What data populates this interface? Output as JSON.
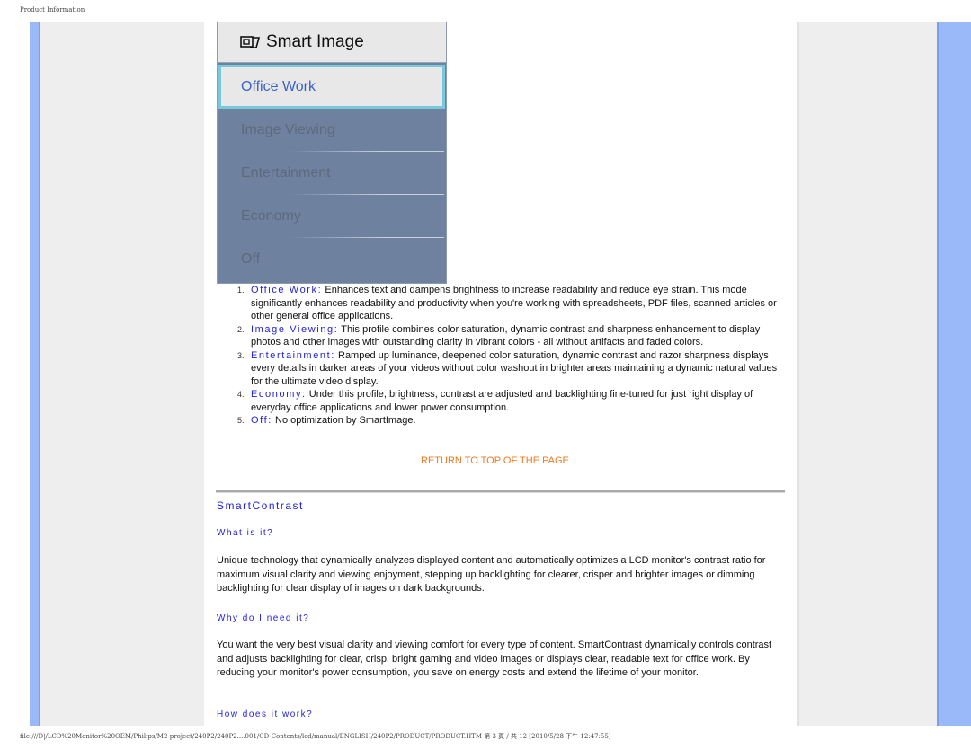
{
  "page": {
    "header": "Product Information",
    "footer": "file:///D|/LCD%20Monitor%20OEM/Philips/M2-project/240P2/240P2....001/CD-Contents/lcd/manual/ENGLISH/240P2/PRODUCT/PRODUCT.HTM 第 3 頁 / 共 12 [2010/5/28 下午 12:47:55]"
  },
  "osd": {
    "icon": "smart-image-icon",
    "title": "Smart Image",
    "selected": "Office Work",
    "items": [
      "Image Viewing",
      "Entertainment",
      "Economy",
      "Off"
    ]
  },
  "profiles": [
    {
      "num": "1.",
      "term": "Office Work:",
      "text": " Enhances text and dampens brightness to increase readability and reduce eye strain. This mode significantly enhances readability and productivity when you're working with spreadsheets, PDF files, scanned articles or other general office applications."
    },
    {
      "num": "2.",
      "term": "Image Viewing:",
      "text": " This profile combines color saturation, dynamic contrast and sharpness enhancement to display photos and other images with outstanding clarity in vibrant colors - all without artifacts and faded colors."
    },
    {
      "num": "3.",
      "term": "Entertainment:",
      "text": " Ramped up luminance, deepened color saturation, dynamic contrast and razor sharpness displays every details in darker areas of your videos without color washout in brighter areas maintaining a dynamic natural values for the ultimate video display."
    },
    {
      "num": "4.",
      "term": "Economy:",
      "text": " Under this profile, brightness, contrast are adjusted and backlighting fine-tuned for just right display of everyday office applications and lower power consumption."
    },
    {
      "num": "5.",
      "term": "Off:",
      "text": " No optimization by SmartImage."
    }
  ],
  "return_link": "RETURN TO TOP OF THE PAGE",
  "smartcontrast": {
    "title": "SmartContrast",
    "what_heading": "What is it?",
    "what_text": "Unique technology that dynamically analyzes displayed content and automatically optimizes a LCD monitor's contrast ratio for maximum visual clarity and viewing enjoyment, stepping up backlighting for clearer, crisper and brighter images or dimming backlighting for clear display of images on dark backgrounds.",
    "why_heading": "Why do I need it?",
    "why_text": "You want the very best visual clarity and viewing comfort for every type of content. SmartContrast dynamically controls contrast and adjusts backlighting for clear, crisp, bright gaming and video images or displays clear, readable text for office work. By reducing your monitor's power consumption, you save on energy costs and extend the lifetime of your monitor.",
    "how_heading": "How does it work?"
  },
  "colors": {
    "side_bar": "#99b9f8",
    "side_panel": "#eeeeee",
    "link_blue": "#2222dd",
    "return_orange": "#f07a20",
    "osd_body": "#6e819e",
    "osd_highlight_border": "#79c9de"
  }
}
